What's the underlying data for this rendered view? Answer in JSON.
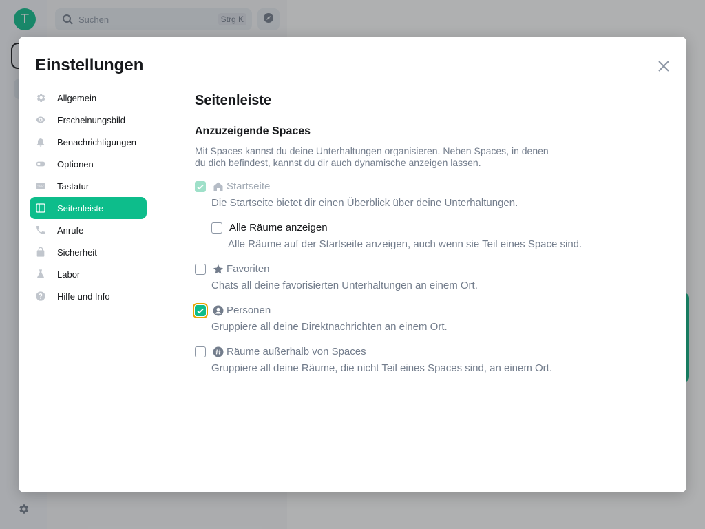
{
  "background": {
    "avatar_letter": "T",
    "search": {
      "placeholder": "Suchen",
      "shortcut": "Strg K"
    }
  },
  "dialog": {
    "title": "Einstellungen",
    "nav": [
      {
        "label": "Allgemein",
        "icon": "gear-icon"
      },
      {
        "label": "Erscheinungsbild",
        "icon": "eye-icon"
      },
      {
        "label": "Benachrichtigungen",
        "icon": "bell-icon"
      },
      {
        "label": "Optionen",
        "icon": "toggle-icon"
      },
      {
        "label": "Tastatur",
        "icon": "keyboard-icon"
      },
      {
        "label": "Seitenleiste",
        "icon": "sidebar-icon",
        "active": true
      },
      {
        "label": "Anrufe",
        "icon": "phone-icon"
      },
      {
        "label": "Sicherheit",
        "icon": "lock-icon"
      },
      {
        "label": "Labor",
        "icon": "flask-icon"
      },
      {
        "label": "Hilfe und Info",
        "icon": "help-icon"
      }
    ],
    "content": {
      "title": "Seitenleiste",
      "subtitle": "Anzuzeigende Spaces",
      "description": "Mit Spaces kannst du deine Unterhaltungen organisieren. Neben Spaces, in denen du dich befindest, kannst du dir auch dynamische anzeigen lassen.",
      "options": {
        "home": {
          "label": "Startseite",
          "desc": "Die Startseite bietet dir einen Überblick über deine Unterhaltungen.",
          "checked": true,
          "disabled": true,
          "icon": "home-icon"
        },
        "all_rooms": {
          "label": "Alle Räume anzeigen",
          "desc": "Alle Räume auf der Startseite anzeigen, auch wenn sie Teil eines Space sind.",
          "checked": false
        },
        "favourites": {
          "label": "Favoriten",
          "desc": "Chats all deine favorisierten Unterhaltungen an einem Ort.",
          "checked": false,
          "icon": "star-icon"
        },
        "people": {
          "label": "Personen",
          "desc": "Gruppiere all deine Direktnachrichten an einem Ort.",
          "checked": true,
          "icon": "person-icon"
        },
        "orphans": {
          "label": "Räume außerhalb von Spaces",
          "desc": "Gruppiere all deine Räume, die nicht Teil eines Spaces sind, an einem Ort.",
          "checked": false,
          "icon": "hash-icon"
        }
      }
    }
  },
  "colors": {
    "accent": "#0dbd8b",
    "focus_ring": "#e6a400"
  }
}
